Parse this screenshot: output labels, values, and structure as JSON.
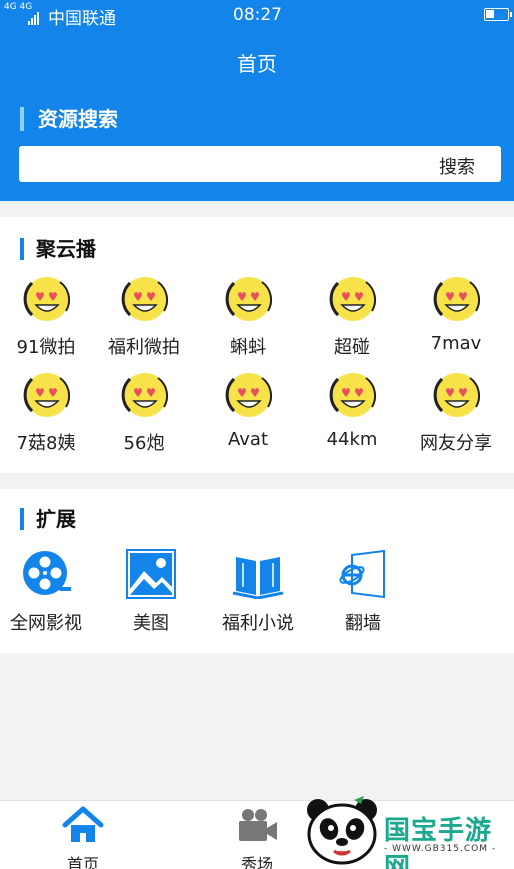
{
  "status_bar": {
    "signal": "4G 4G",
    "carrier": "中国联通",
    "time": "08:27"
  },
  "nav": {
    "title": "首页"
  },
  "search": {
    "heading": "资源搜索",
    "placeholder": "",
    "button": "搜索"
  },
  "juyunbo": {
    "title": "聚云播",
    "items": [
      {
        "label": "91微拍",
        "icon": "heart-eyes-emoji-icon"
      },
      {
        "label": "福利微拍",
        "icon": "heart-eyes-emoji-icon"
      },
      {
        "label": "蝌蚪",
        "icon": "heart-eyes-emoji-icon"
      },
      {
        "label": "超碰",
        "icon": "heart-eyes-emoji-icon"
      },
      {
        "label": "7mav",
        "icon": "heart-eyes-emoji-icon"
      },
      {
        "label": "7菇8姨",
        "icon": "heart-eyes-emoji-icon"
      },
      {
        "label": "56炮",
        "icon": "heart-eyes-emoji-icon"
      },
      {
        "label": "Avat",
        "icon": "heart-eyes-emoji-icon"
      },
      {
        "label": "44km",
        "icon": "heart-eyes-emoji-icon"
      },
      {
        "label": "网友分享",
        "icon": "heart-eyes-emoji-icon"
      }
    ]
  },
  "extensions": {
    "title": "扩展",
    "items": [
      {
        "label": "全网影视",
        "icon": "film-reel-icon"
      },
      {
        "label": "美图",
        "icon": "picture-icon"
      },
      {
        "label": "福利小说",
        "icon": "open-book-icon"
      },
      {
        "label": "翻墙",
        "icon": "ie-browser-icon"
      }
    ]
  },
  "tabbar": {
    "tabs": [
      {
        "label": "首页",
        "icon": "home-icon"
      },
      {
        "label": "秀场",
        "icon": "video-camera-icon"
      }
    ]
  },
  "watermark": {
    "text": "国宝手游网",
    "url": "- WWW.GB315.COM -"
  },
  "colors": {
    "primary": "#1284ea",
    "accent": "#1aa88e",
    "emoji": "#f7e24a"
  }
}
